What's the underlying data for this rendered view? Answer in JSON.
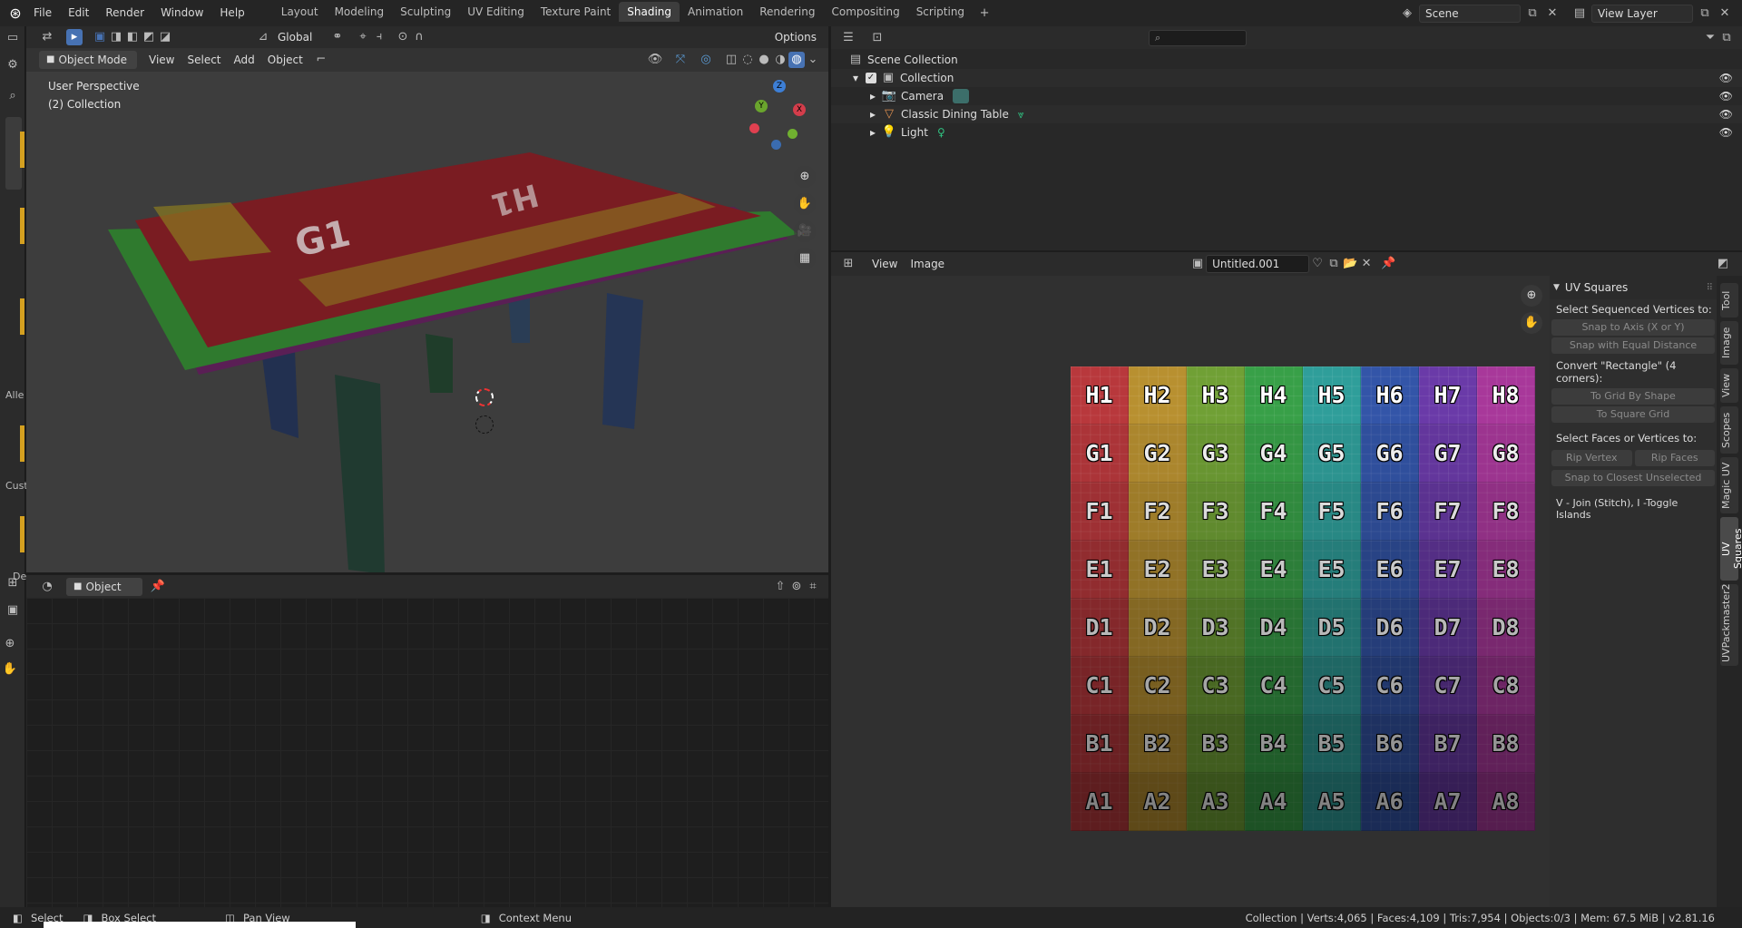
{
  "menus": [
    "File",
    "Edit",
    "Render",
    "Window",
    "Help"
  ],
  "workspaces": [
    "Layout",
    "Modeling",
    "Sculpting",
    "UV Editing",
    "Texture Paint",
    "Shading",
    "Animation",
    "Rendering",
    "Compositing",
    "Scripting"
  ],
  "active_workspace": "Shading",
  "scene": "Scene",
  "view_layer": "View Layer",
  "tool_header": {
    "orientation": "Global",
    "options": "Options"
  },
  "viewport": {
    "mode": "Object Mode",
    "menus": [
      "View",
      "Select",
      "Add",
      "Object"
    ],
    "perspective": "User Perspective",
    "collection": "(2) Collection",
    "gizmo": {
      "x": "X",
      "y": "Y",
      "z": "Z"
    }
  },
  "left_strip_labels": [
    "Alle",
    "Cust",
    "De"
  ],
  "outliner": {
    "root": "Scene Collection",
    "collection": "Collection",
    "items": [
      "Camera",
      "Classic Dining Table",
      "Light"
    ]
  },
  "image_editor": {
    "menus": [
      "View",
      "Image"
    ],
    "image_name": "Untitled.001",
    "uv_rows": [
      [
        "H1",
        "H2",
        "H3",
        "H4",
        "H5",
        "H6",
        "H7",
        "H8"
      ],
      [
        "G1",
        "G2",
        "G3",
        "G4",
        "G5",
        "G6",
        "G7",
        "G8"
      ],
      [
        "F1",
        "F2",
        "F3",
        "F4",
        "F5",
        "F6",
        "F7",
        "F8"
      ],
      [
        "E1",
        "E2",
        "E3",
        "E4",
        "E5",
        "E6",
        "E7",
        "E8"
      ],
      [
        "D1",
        "D2",
        "D3",
        "D4",
        "D5",
        "D6",
        "D7",
        "D8"
      ],
      [
        "C1",
        "C2",
        "C3",
        "C4",
        "C5",
        "C6",
        "C7",
        "C8"
      ],
      [
        "B1",
        "B2",
        "B3",
        "B4",
        "B5",
        "B6",
        "B7",
        "B8"
      ],
      [
        "A1",
        "A2",
        "A3",
        "A4",
        "A5",
        "A6",
        "A7",
        "A8"
      ]
    ],
    "column_colors": [
      "#b8383c",
      "#b89030",
      "#70a035",
      "#38a048",
      "#2f9e9a",
      "#3355a8",
      "#6a3aa8",
      "#a8389a"
    ]
  },
  "uv_squares_panel": {
    "title": "UV Squares",
    "label1": "Select Sequenced Vertices to:",
    "snap_axis": "Snap to Axis (X or Y)",
    "snap_equal": "Snap with Equal Distance",
    "label2": "Convert \"Rectangle\" (4 corners):",
    "grid_shape": "To Grid By Shape",
    "square_grid": "To Square Grid",
    "label3": "Select Faces or Vertices to:",
    "rip_vertex": "Rip Vertex",
    "rip_faces": "Rip Faces",
    "snap_closest": "Snap to Closest Unselected",
    "hint": "V - Join (Stitch), I -Toggle Islands"
  },
  "side_tabs": [
    "Tool",
    "Image",
    "View",
    "Scopes",
    "Magic UV",
    "UV Squares",
    "UVPackmaster2"
  ],
  "node_editor": {
    "object_label": "Object"
  },
  "statusbar": {
    "select": "Select",
    "box_select": "Box Select",
    "pan_view": "Pan View",
    "context_menu": "Context Menu",
    "stats": "Collection | Verts:4,065 | Faces:4,109 | Tris:7,954 | Objects:0/3 | Mem: 67.5 MiB | v2.81.16"
  },
  "colors": {
    "accent_blue": "#4772b3",
    "active_tab": "#3d3d3d",
    "panel_bg": "#2b2b2b"
  }
}
